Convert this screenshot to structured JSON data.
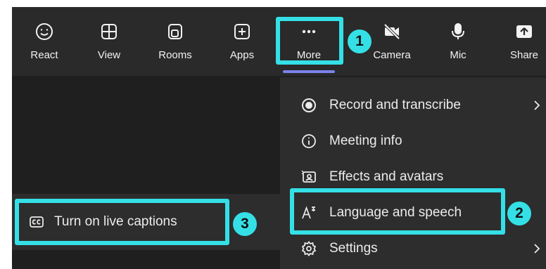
{
  "toolbar": {
    "react_label": "React",
    "view_label": "View",
    "rooms_label": "Rooms",
    "apps_label": "Apps",
    "more_label": "More",
    "camera_label": "Camera",
    "mic_label": "Mic",
    "share_label": "Share"
  },
  "more_menu": {
    "items": [
      {
        "label": "Record and transcribe",
        "icon": "record-icon",
        "has_submenu": true
      },
      {
        "label": "Meeting info",
        "icon": "info-icon",
        "has_submenu": false
      },
      {
        "label": "Effects and avatars",
        "icon": "effects-icon",
        "has_submenu": false
      },
      {
        "label": "Language and speech",
        "icon": "language-icon",
        "has_submenu": false
      },
      {
        "label": "Settings",
        "icon": "gear-icon",
        "has_submenu": true
      }
    ]
  },
  "submenu": {
    "live_captions_label": "Turn on live captions",
    "icon": "cc-icon"
  },
  "annotations": {
    "badge_1": "1",
    "badge_2": "2",
    "badge_3": "3",
    "highlight_color": "#34e0e6"
  },
  "colors": {
    "background": "#1f1f1f",
    "toolbar": "#2a2a2a",
    "menu": "#2d2d2d",
    "accent": "#7b83eb"
  }
}
